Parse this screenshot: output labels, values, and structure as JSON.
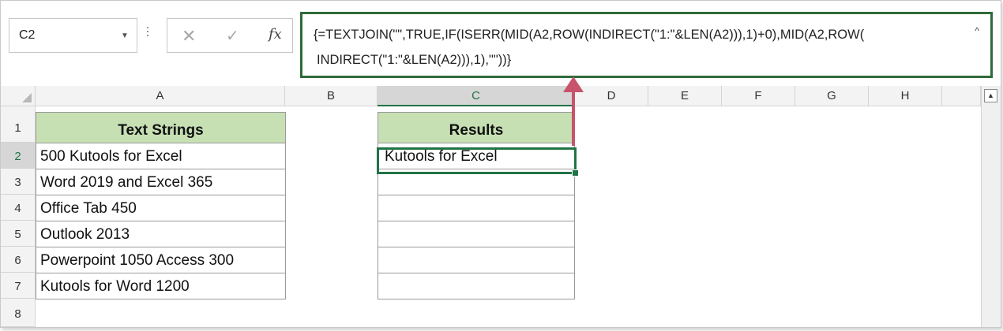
{
  "namebox": {
    "value": "C2"
  },
  "formula_bar": {
    "line1": "{=TEXTJOIN(\"\",TRUE,IF(ISERR(MID(A2,ROW(INDIRECT(\"1:\"&LEN(A2))),1)+0),MID(A2,ROW(",
    "line2": "INDIRECT(\"1:\"&LEN(A2))),1),\"\"))}",
    "fx_label": "fx"
  },
  "columns": [
    "A",
    "B",
    "C",
    "D",
    "E",
    "F",
    "G",
    "H"
  ],
  "rows": [
    "1",
    "2",
    "3",
    "4",
    "5",
    "6",
    "7",
    "8"
  ],
  "cells": {
    "A1": "Text Strings",
    "A2": "500 Kutools for Excel",
    "A3": "Word 2019 and Excel 365",
    "A4": "Office Tab 450",
    "A5": "Outlook 2013",
    "A6": "Powerpoint 1050 Access 300",
    "A7": "Kutools for Word 1200",
    "C1": "Results",
    "C2": "Kutools for Excel"
  },
  "colors": {
    "header_fill": "#c6e0b4",
    "selection": "#217346",
    "annotation_arrow": "#c8536a"
  }
}
